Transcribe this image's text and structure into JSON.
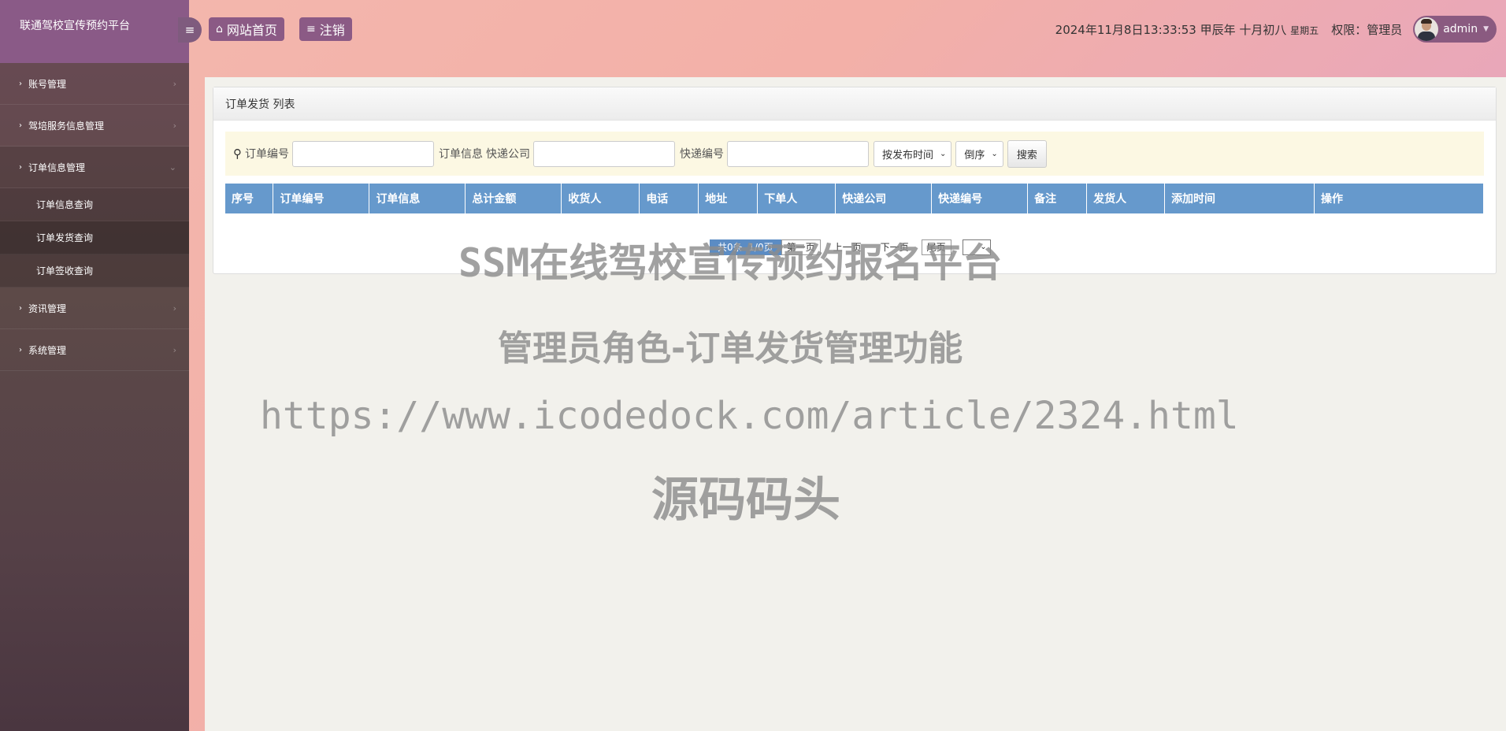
{
  "app": {
    "title": "联通驾校宣传预约平台"
  },
  "sidebar": {
    "items": [
      {
        "label": "账号管理"
      },
      {
        "label": "驾培服务信息管理"
      },
      {
        "label": "订单信息管理",
        "children": [
          "订单信息查询",
          "订单发货查询",
          "订单签收查询"
        ]
      },
      {
        "label": "资讯管理"
      },
      {
        "label": "系统管理"
      }
    ]
  },
  "topbar": {
    "home_label": "网站首页",
    "logout_label": "注销",
    "datetime": "2024年11月8日13:33:53 甲辰年 十月初八",
    "weekday": "星期五",
    "permission": "权限：管理员",
    "username": "admin"
  },
  "panel": {
    "title": "订单发货 列表",
    "search": {
      "label_order_no": "订单编号",
      "label_order_info": "订单信息",
      "label_courier": "快递公司",
      "label_tracking": "快递编号",
      "sort_field": "按发布时间",
      "sort_order": "倒序",
      "search_button": "搜索"
    },
    "table": {
      "columns": [
        "序号",
        "订单编号",
        "订单信息",
        "总计金额",
        "收货人",
        "电话",
        "地址",
        "下单人",
        "快递公司",
        "快递编号",
        "备注",
        "发货人",
        "添加时间",
        "操作"
      ]
    },
    "pager": {
      "total": "共0条",
      "page": "1/0页",
      "first": "第一页",
      "prev": "上一页",
      "next": "下一页",
      "last": "尾页"
    }
  },
  "watermark": {
    "line1": "SSM在线驾校宣传预约报名平台",
    "line2": "管理员角色-订单发货管理功能",
    "line3": "https://www.icodedock.com/article/2324.html",
    "line4": "源码码头"
  }
}
